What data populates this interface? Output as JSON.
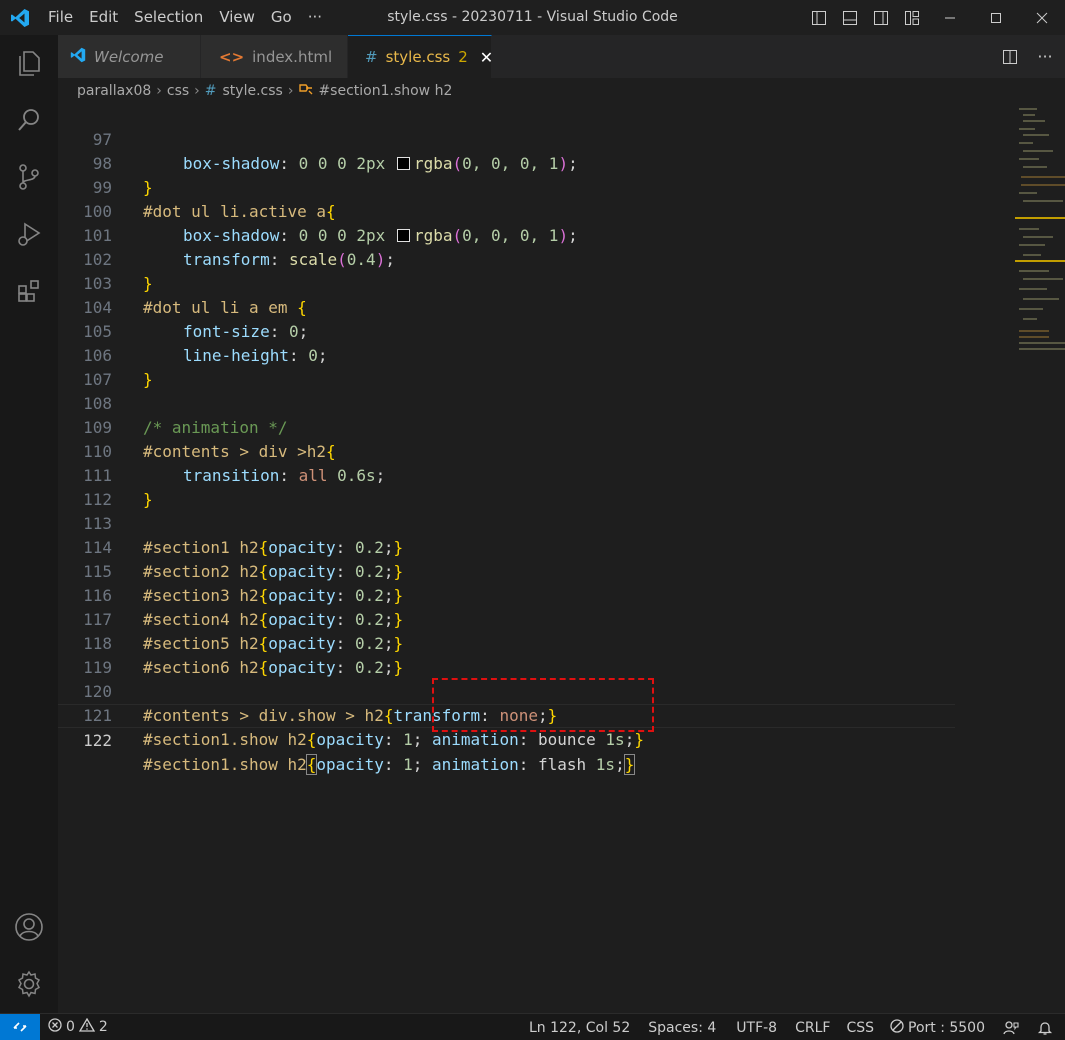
{
  "window": {
    "title": "style.css - 20230711 - Visual Studio Code"
  },
  "menu": [
    "File",
    "Edit",
    "Selection",
    "View",
    "Go",
    "···"
  ],
  "tabs": [
    {
      "label": "Welcome",
      "icon": "vscode-logo-icon"
    },
    {
      "label": "index.html",
      "icon": "html-icon"
    },
    {
      "label": "style.css",
      "icon": "css-hash-icon",
      "badge": "2",
      "active": true
    }
  ],
  "tab_icons": {
    "html": "<>",
    "css": "#",
    "close": "✕"
  },
  "breadcrumb": [
    "parallax08",
    "css",
    "style.css",
    "#section1.show h2"
  ],
  "breadcrumb_icons": {
    "css": "#"
  },
  "editor": {
    "lines": [
      {
        "n": "97"
      },
      {
        "n": "98"
      },
      {
        "n": "99"
      },
      {
        "n": "100"
      },
      {
        "n": "101"
      },
      {
        "n": "102"
      },
      {
        "n": "103"
      },
      {
        "n": "104"
      },
      {
        "n": "105"
      },
      {
        "n": "106"
      },
      {
        "n": "107"
      },
      {
        "n": "108"
      },
      {
        "n": "109"
      },
      {
        "n": "110"
      },
      {
        "n": "111"
      },
      {
        "n": "112"
      },
      {
        "n": "113"
      },
      {
        "n": "114"
      },
      {
        "n": "115"
      },
      {
        "n": "116"
      },
      {
        "n": "117"
      },
      {
        "n": "118"
      },
      {
        "n": "119"
      },
      {
        "n": "120"
      },
      {
        "n": "121"
      },
      {
        "n": "122"
      }
    ],
    "code": {
      "l97_prop": "box-shadow",
      "l97_vals": " 0 0 0 2px ",
      "l97_fn": "rgba",
      "l97_args": "0, 0, 0, 1",
      "l99_sel": "#dot ul li.active a",
      "l100_prop": "box-shadow",
      "l100_vals": " 0 0 0 2px ",
      "l100_fn": "rgba",
      "l100_args": "0, 0, 0, 1",
      "l101_prop": "transform",
      "l101_fn": "scale",
      "l101_arg": "0.4",
      "l103_sel": "#dot ul li a em ",
      "l104_prop": "font-size",
      "l104_val": "0",
      "l105_prop": "line-height",
      "l105_val": "0",
      "l108_comment": "/* animation */",
      "l109_sel": "#contents > div >h2",
      "l110_prop": "transition",
      "l110_v1": "all",
      "l110_v2": "0.6s",
      "l113_sel": "#section1 h2",
      "l114_sel": "#section2 h2",
      "l115_sel": "#section3 h2",
      "l116_sel": "#section4 h2",
      "l117_sel": "#section5 h2",
      "l118_sel": "#section6 h2",
      "opacity_prop": "opacity",
      "opacity_val": "0.2",
      "l120_sel": "#contents > div.show > h2",
      "l120_prop": "transform",
      "l120_val": "none",
      "l121_sel": "#section1.show h2",
      "l121_op": "1",
      "l121_anim": "bounce",
      "l121_dur": "1s",
      "l122_sel": "#section1.show h2",
      "l122_op": "1",
      "l122_anim": "flash",
      "l122_dur": "1s",
      "anim_prop": "animation"
    }
  },
  "status": {
    "errors": "0",
    "warnings": "2",
    "position": "Ln 122, Col 52",
    "spaces": "Spaces: 4",
    "encoding": "UTF-8",
    "eol": "CRLF",
    "language": "CSS",
    "port": "Port : 5500"
  },
  "colors": {
    "accent": "#0078d4",
    "highlight_box": "#e01010"
  }
}
